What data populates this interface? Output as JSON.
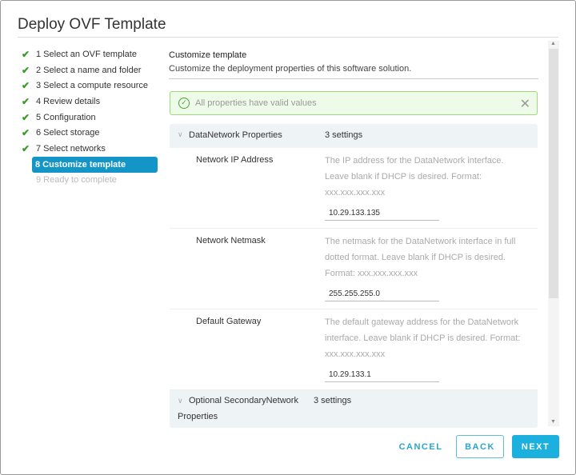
{
  "title": "Deploy OVF Template",
  "steps": [
    {
      "label": "1 Select an OVF template",
      "state": "done"
    },
    {
      "label": "2 Select a name and folder",
      "state": "done"
    },
    {
      "label": "3 Select a compute resource",
      "state": "done"
    },
    {
      "label": "4 Review details",
      "state": "done"
    },
    {
      "label": "5 Configuration",
      "state": "done"
    },
    {
      "label": "6 Select storage",
      "state": "done"
    },
    {
      "label": "7 Select networks",
      "state": "done"
    },
    {
      "label": "8 Customize template",
      "state": "active"
    },
    {
      "label": "9 Ready to complete",
      "state": "pending"
    }
  ],
  "content": {
    "title": "Customize template",
    "subtitle": "Customize the deployment properties of this software solution."
  },
  "alert": {
    "text": "All properties have valid values",
    "icon": "check-circle-icon"
  },
  "sections": [
    {
      "name": "DataNetwork Properties",
      "count": "3 settings",
      "rows": [
        {
          "label": "Network IP Address",
          "desc": "The IP address for the DataNetwork interface. Leave blank if DHCP is desired. Format: xxx.xxx.xxx.xxx",
          "value": "10.29.133.135"
        },
        {
          "label": "Network Netmask",
          "desc": "The netmask for the DataNetwork interface in full dotted format. Leave blank if DHCP is desired. Format: xxx.xxx.xxx.xxx",
          "value": "255.255.255.0"
        },
        {
          "label": "Default Gateway",
          "desc": "The default gateway address for the DataNetwork interface. Leave blank if DHCP is desired. Format: xxx.xxx.xxx.xxx",
          "value": "10.29.133.1"
        }
      ]
    },
    {
      "name": "Optional SecondaryNetwork Properties",
      "count": "3 settings"
    }
  ],
  "buttons": {
    "cancel": "CANCEL",
    "back": "BACK",
    "next": "NEXT"
  }
}
